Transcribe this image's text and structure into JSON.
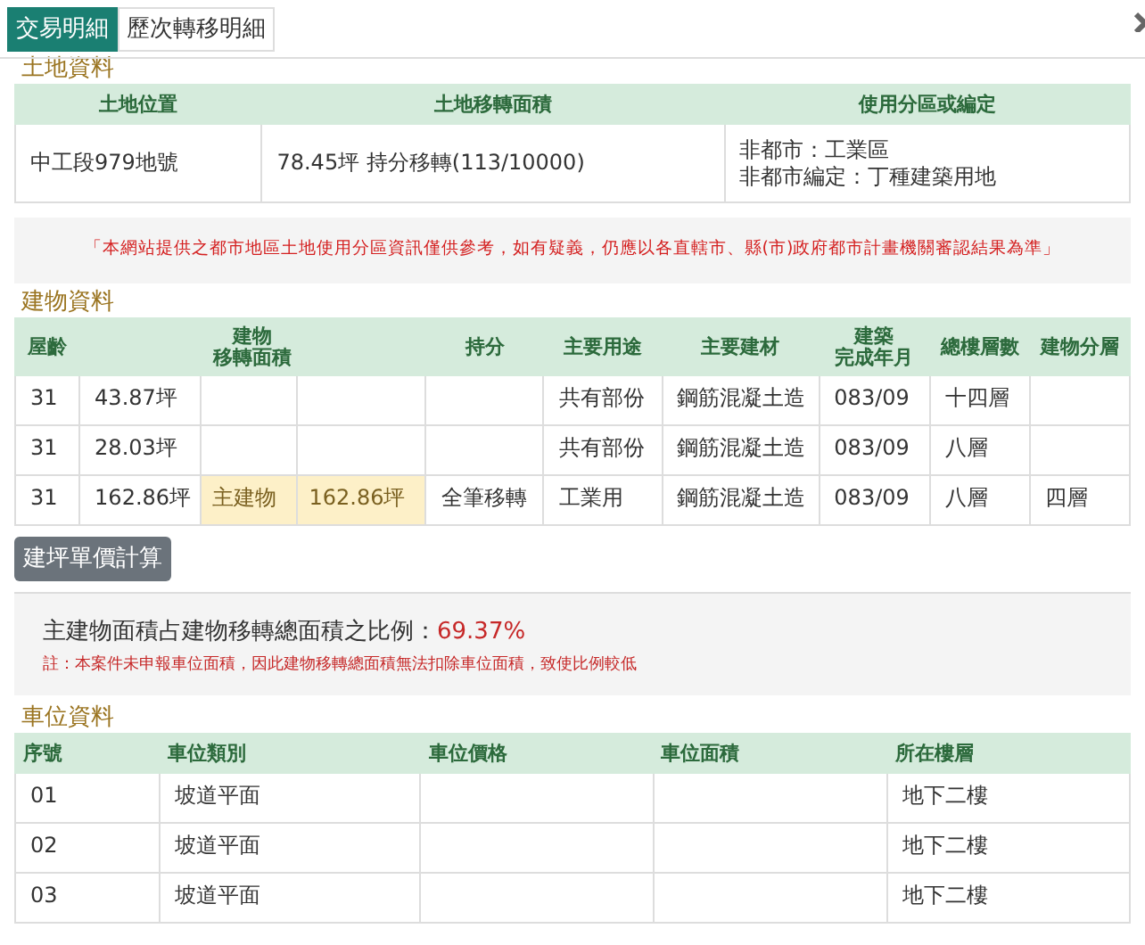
{
  "tabs": [
    {
      "label": "交易明細",
      "selected": true
    },
    {
      "label": "歷次轉移明細",
      "selected": false
    }
  ],
  "land": {
    "title": "土地資料",
    "columns": [
      "土地位置",
      "土地移轉面積",
      "使用分區或編定"
    ],
    "rows": [
      {
        "location": "中工段979地號",
        "area": "78.45坪 持分移轉(113/10000)",
        "zoning": [
          "非都市：工業區",
          "非都市編定：丁種建築用地"
        ]
      }
    ]
  },
  "notice": "「本網站提供之都市地區土地使用分區資訊僅供參考，如有疑義，仍應以各直轄市、縣(市)政府都市計畫機關審認結果為準」",
  "building": {
    "title": "建物資料",
    "columns": [
      "屋齡",
      [
        "建物",
        "移轉面積"
      ],
      "持分",
      "主要用途",
      "主要建材",
      [
        "建築",
        "完成年月"
      ],
      "總樓層數",
      "建物分層"
    ],
    "rows": [
      {
        "age": "31",
        "area": "43.87坪",
        "main_label": "",
        "main_area": "",
        "share": "",
        "use": "共有部份",
        "material": "鋼筋混凝土造",
        "completed": "083/09",
        "floors": "十四層",
        "floor_level": ""
      },
      {
        "age": "31",
        "area": "28.03坪",
        "main_label": "",
        "main_area": "",
        "share": "",
        "use": "共有部份",
        "material": "鋼筋混凝土造",
        "completed": "083/09",
        "floors": "八層",
        "floor_level": ""
      },
      {
        "age": "31",
        "area": "162.86坪",
        "main_label": "主建物",
        "main_area": "162.86坪",
        "share": "全筆移轉",
        "use": "工業用",
        "material": "鋼筋混凝土造",
        "completed": "083/09",
        "floors": "八層",
        "floor_level": "四層"
      }
    ]
  },
  "calc_button": "建坪單價計算",
  "ratio": {
    "label": "主建物面積占建物移轉總面積之比例：",
    "value": "69.37%",
    "note": "註：本案件未申報車位面積，因此建物移轉總面積無法扣除車位面積，致使比例較低"
  },
  "parking": {
    "title": "車位資料",
    "columns": [
      "序號",
      "車位類別",
      "車位價格",
      "車位面積",
      "所在樓層"
    ],
    "rows": [
      {
        "no": "01",
        "type": "坡道平面",
        "price": "",
        "area": "",
        "floor": "地下二樓"
      },
      {
        "no": "02",
        "type": "坡道平面",
        "price": "",
        "area": "",
        "floor": "地下二樓"
      },
      {
        "no": "03",
        "type": "坡道平面",
        "price": "",
        "area": "",
        "floor": "地下二樓"
      }
    ]
  }
}
